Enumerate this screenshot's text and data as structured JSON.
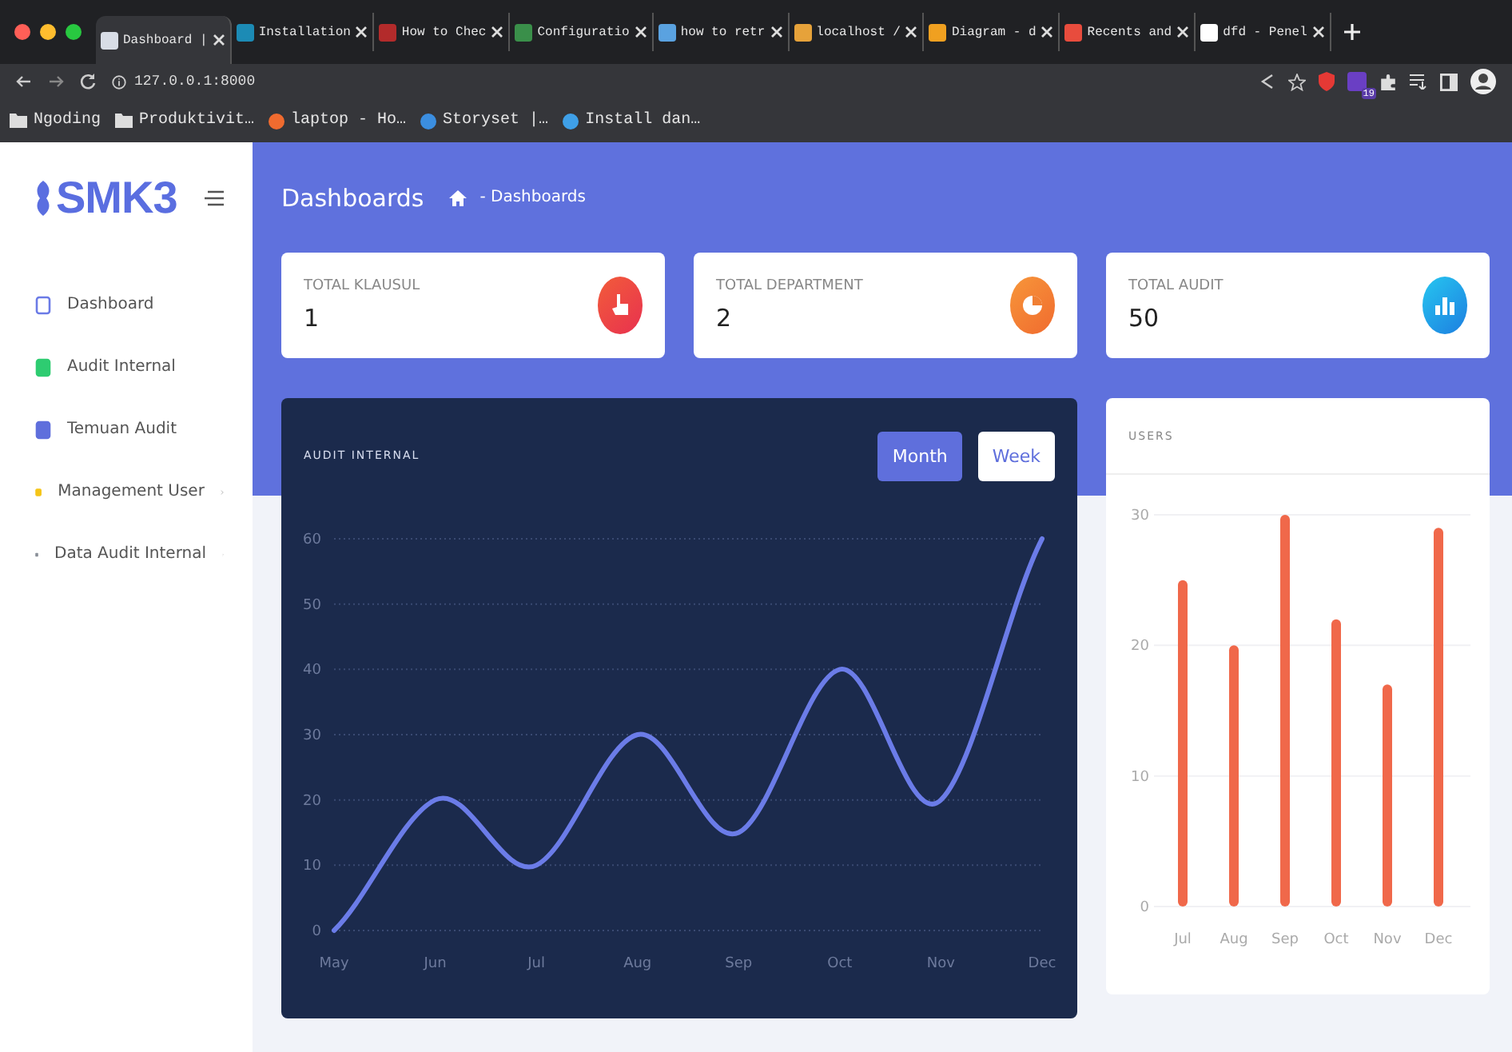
{
  "browser": {
    "tabs": [
      {
        "label": "Dashboard |",
        "selected": true
      },
      {
        "label": "Installation",
        "selected": false
      },
      {
        "label": "How to Chec",
        "selected": false
      },
      {
        "label": "Configuratio",
        "selected": false
      },
      {
        "label": "how to retr",
        "selected": false
      },
      {
        "label": "localhost /",
        "selected": false
      },
      {
        "label": "Diagram - d",
        "selected": false
      },
      {
        "label": "Recents and",
        "selected": false
      },
      {
        "label": "dfd - Penel",
        "selected": false
      }
    ],
    "address": "127.0.0.1:8000",
    "extension_badge": "19",
    "bookmarks": [
      {
        "label": "Ngoding",
        "kind": "folder"
      },
      {
        "label": "Produktivit…",
        "kind": "folder"
      },
      {
        "label": "laptop - Ho…",
        "kind": "site"
      },
      {
        "label": "Storyset |…",
        "kind": "site"
      },
      {
        "label": "Install dan…",
        "kind": "site"
      }
    ]
  },
  "sidebar": {
    "logo": "SMK3",
    "items": [
      {
        "label": "Dashboard",
        "expandable": false
      },
      {
        "label": "Audit Internal",
        "expandable": false
      },
      {
        "label": "Temuan Audit",
        "expandable": false
      },
      {
        "label": "Management User",
        "expandable": true
      },
      {
        "label": "Data Audit Internal",
        "expandable": true
      }
    ]
  },
  "header": {
    "title": "Dashboards",
    "breadcrumb": "- Dashboards"
  },
  "stats": [
    {
      "label": "TOTAL KLAUSUL",
      "value": "1"
    },
    {
      "label": "TOTAL DEPARTMENT",
      "value": "2"
    },
    {
      "label": "TOTAL AUDIT",
      "value": "50"
    }
  ],
  "audit_chart": {
    "toggle": [
      {
        "label": "Month",
        "selected": true
      },
      {
        "label": "Week",
        "selected": false
      }
    ],
    "chart_data": {
      "type": "line",
      "title": "AUDIT INTERNAL",
      "categories": [
        "May",
        "Jun",
        "Jul",
        "Aug",
        "Sep",
        "Oct",
        "Nov",
        "Dec"
      ],
      "values": [
        0,
        20,
        10,
        30,
        15,
        40,
        20,
        60
      ],
      "ylim": [
        0,
        60
      ],
      "yticks": [
        0,
        10,
        20,
        30,
        40,
        50,
        60
      ],
      "grid": true
    }
  },
  "users_chart": {
    "chart_data": {
      "type": "bar",
      "title": "USERS",
      "categories": [
        "Jul",
        "Aug",
        "Sep",
        "Oct",
        "Nov",
        "Dec"
      ],
      "values": [
        25,
        20,
        30,
        22,
        17,
        29
      ],
      "ylim": [
        0,
        30
      ],
      "yticks": [
        0,
        10,
        20,
        30
      ],
      "grid": true
    }
  }
}
